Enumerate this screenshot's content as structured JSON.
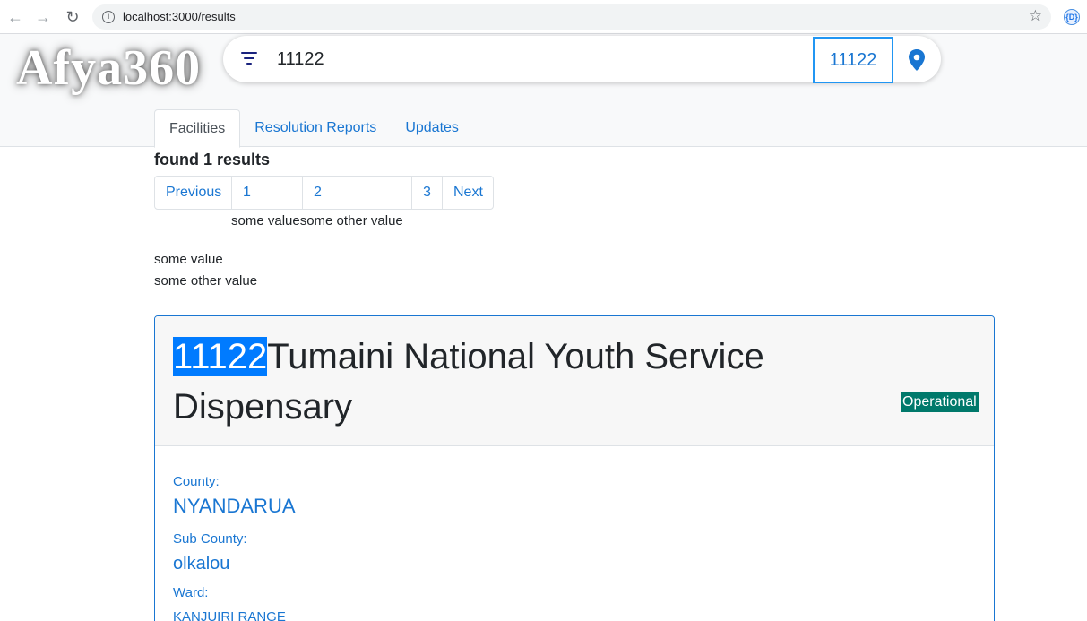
{
  "browser": {
    "url": "localhost:3000/results",
    "extension_label": "{D}"
  },
  "header": {
    "logo": "Afya360",
    "search_value": "11122",
    "search_button_label": "11122",
    "tabs": [
      {
        "label": "Facilities",
        "active": true
      },
      {
        "label": "Resolution Reports",
        "active": false
      },
      {
        "label": "Updates",
        "active": false
      }
    ]
  },
  "results": {
    "count_text": "found 1 results",
    "pagination": [
      "Previous",
      "1",
      "2",
      "3",
      "Next"
    ],
    "inline_values": "some valuesome other value",
    "stack_values": [
      "some value",
      "some other value"
    ]
  },
  "facility": {
    "code": "11122",
    "name": "Tumaini National Youth Service Dispensary",
    "status": "Operational",
    "fields": {
      "county_label": "County:",
      "county_value": "NYANDARUA",
      "sub_county_label": "Sub County:",
      "sub_county_value": "olkalou",
      "ward_label": "Ward:",
      "ward_value": "KANJUIRI RANGE"
    }
  },
  "colors": {
    "accent": "#1976d2",
    "highlight": "#007bff",
    "status": "#00796b"
  }
}
